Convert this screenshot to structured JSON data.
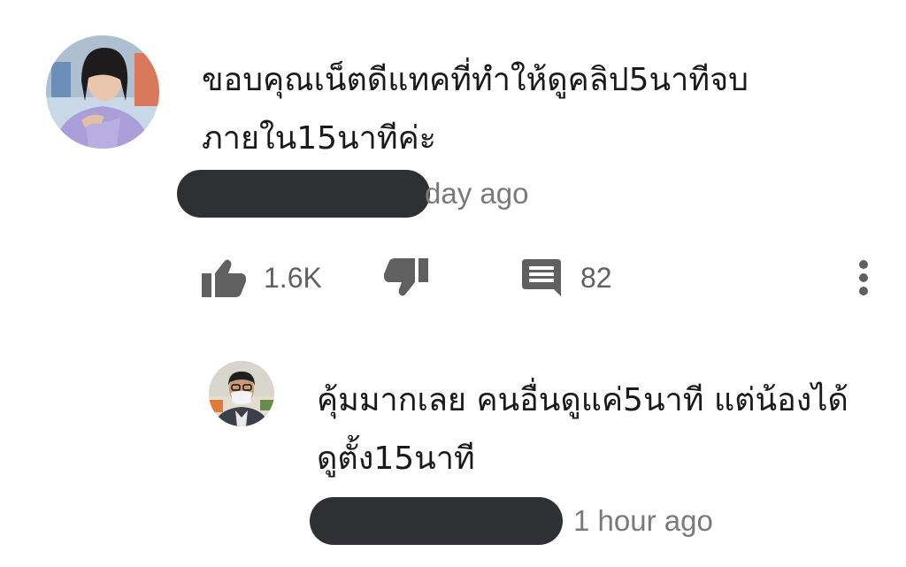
{
  "main_comment": {
    "text": "ขอบคุณเน็ตดีแทคที่ทำให้ดูคลิป5นาทีจบภายใน15นาทีค่ะ",
    "time": "day ago",
    "like_count": "1.6K",
    "reply_count": "82",
    "icons": {
      "like": "thumbs-up-icon",
      "dislike": "thumbs-down-icon",
      "reply": "comment-icon",
      "more": "more-vert-icon"
    }
  },
  "reply_comment": {
    "text": "คุ้มมากเลย คนอื่นดูแค่5นาที แต่น้องได้ดูตั้ง15นาที",
    "time": "1 hour ago"
  },
  "colors": {
    "text": "#1a1a1a",
    "meta": "#7a7a7a",
    "icon": "#606060",
    "redaction": "#2e3033"
  }
}
